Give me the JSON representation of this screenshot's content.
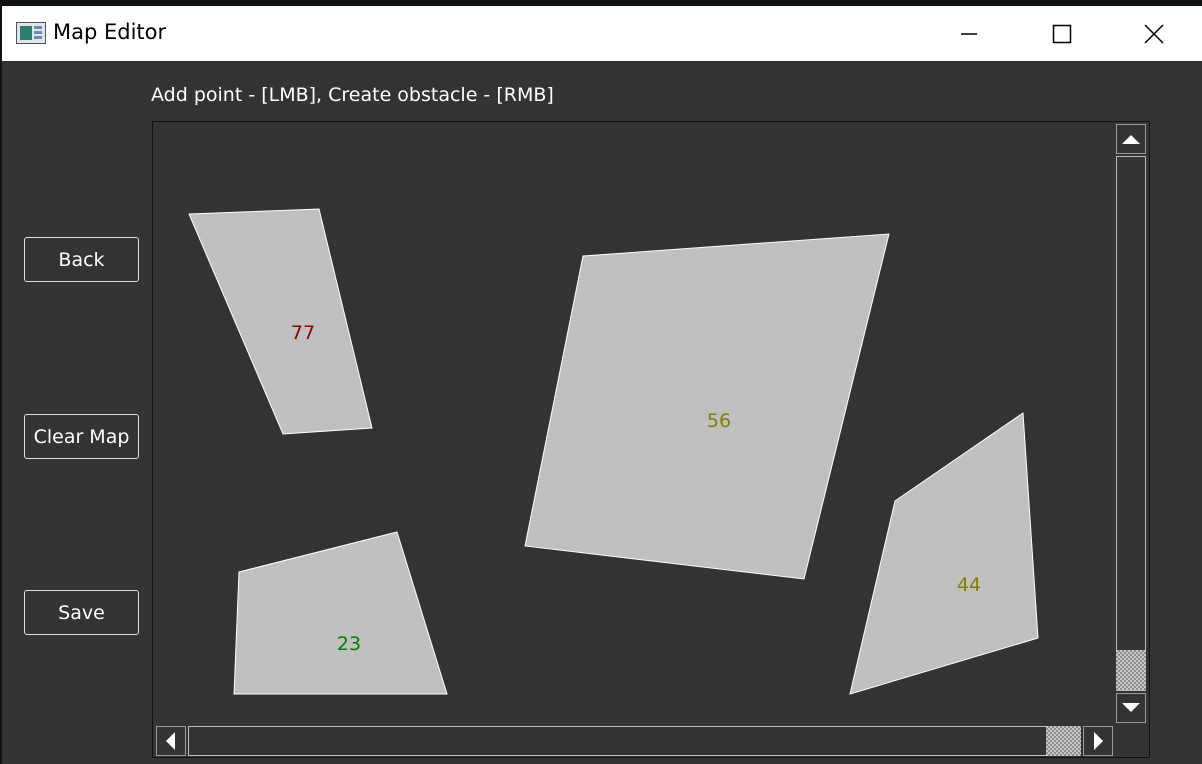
{
  "window": {
    "title": "Map Editor",
    "icon": "app-window-icon",
    "controls": [
      "minimize-icon",
      "maximize-icon",
      "close-icon"
    ]
  },
  "hint": "Add point - [LMB], Create obstacle - [RMB]",
  "sidebar": {
    "back_label": "Back",
    "clear_label": "Clear Map",
    "save_label": "Save"
  },
  "map": {
    "obstacle_fill": "#c0c0c0",
    "obstacles": [
      {
        "label": "77",
        "color": "#8b0000"
      },
      {
        "label": "56",
        "color": "#808000"
      },
      {
        "label": "44",
        "color": "#808000"
      },
      {
        "label": "23",
        "color": "#008000"
      }
    ]
  },
  "scrollbars": {
    "up_icon": "triangle-up-icon",
    "down_icon": "triangle-down-icon",
    "left_icon": "triangle-left-icon",
    "right_icon": "triangle-right-icon"
  }
}
